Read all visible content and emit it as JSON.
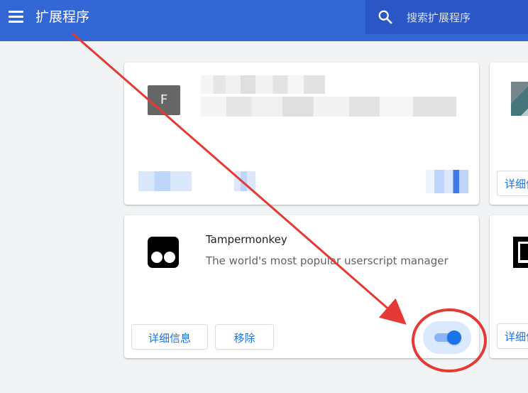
{
  "topbar": {
    "title": "扩展程序",
    "search_placeholder": "搜索扩展程序"
  },
  "cards": {
    "top_left": {
      "letter": "F"
    },
    "tampermonkey": {
      "name": "Tampermonkey",
      "description": "The world's most popular userscript manager",
      "details_button": "详细信息",
      "remove_button": "移除",
      "enabled": true
    },
    "right_partial": {
      "details_button": "详细信息"
    }
  },
  "colors": {
    "header": "#3367d6",
    "search": "#2a56c6",
    "accent": "#1a73e8",
    "toggle_track": "#8ab4f8",
    "annotation": "#e53935"
  },
  "icons": {
    "menu": "menu-icon",
    "search": "search-icon",
    "tampermonkey": "tampermonkey-icon",
    "partial_extension": "partial-extension-icon"
  }
}
